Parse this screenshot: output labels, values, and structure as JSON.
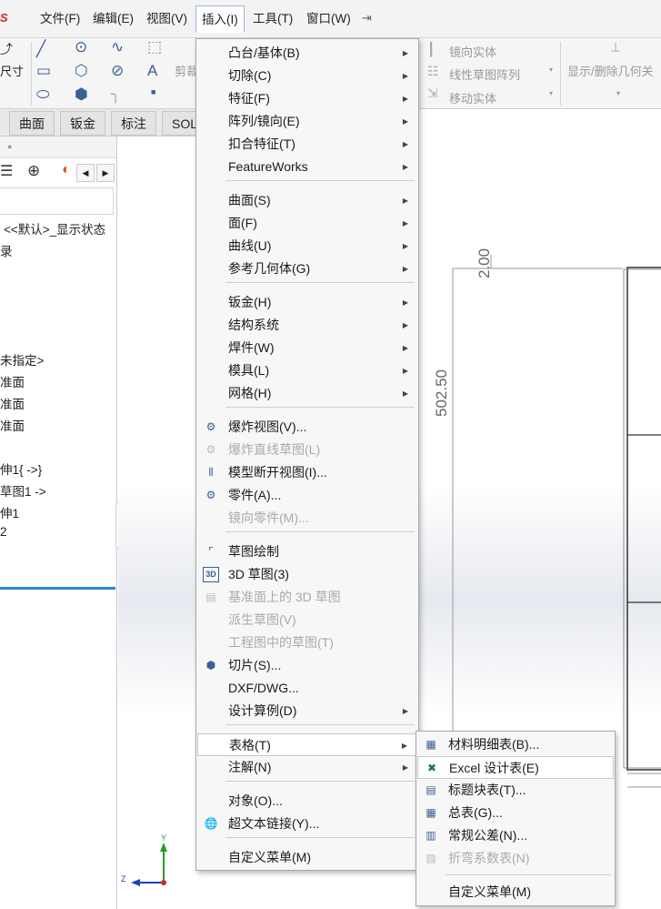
{
  "menubar": {
    "logo": "S",
    "items": [
      "文件(F)",
      "编辑(E)",
      "视图(V)",
      "插入(I)",
      "工具(T)",
      "窗口(W)"
    ],
    "pin_icon": "pin-icon"
  },
  "toolbar": {
    "smart_dim": "尺寸",
    "trim": "剪裁",
    "mirror": "镜向实体",
    "linear_pattern": "线性草图阵列",
    "move": "移动实体",
    "show_delete": "显示/删除几何关"
  },
  "tabs": [
    "曲面",
    "钣金",
    "标注",
    "SOL"
  ],
  "tree": {
    "display_state": "<<默认>_显示状态",
    "items": [
      "录",
      "未指定>",
      "准面",
      "准面",
      "准面",
      "伸1{ ->}",
      "草图1 ->",
      "伸1",
      "2"
    ]
  },
  "graphics": {
    "dim1": "2.00",
    "dim2": "502.50",
    "triad_y": "Y",
    "triad_z": "Z"
  },
  "insert_menu": {
    "items": [
      {
        "label": "凸台/基体(B)",
        "submenu": true
      },
      {
        "label": "切除(C)",
        "submenu": true
      },
      {
        "label": "特征(F)",
        "submenu": true
      },
      {
        "label": "阵列/镜向(E)",
        "submenu": true
      },
      {
        "label": "扣合特征(T)",
        "submenu": true
      },
      {
        "label": "FeatureWorks",
        "submenu": true
      },
      {
        "label": "曲面(S)",
        "submenu": true
      },
      {
        "label": "面(F)",
        "submenu": true
      },
      {
        "label": "曲线(U)",
        "submenu": true
      },
      {
        "label": "参考几何体(G)",
        "submenu": true
      },
      {
        "label": "钣金(H)",
        "submenu": true
      },
      {
        "label": "结构系统",
        "submenu": true
      },
      {
        "label": "焊件(W)",
        "submenu": true
      },
      {
        "label": "模具(L)",
        "submenu": true
      },
      {
        "label": "网格(H)",
        "submenu": true
      },
      {
        "label": "爆炸视图(V)...",
        "icon": "explode-view-icon"
      },
      {
        "label": "爆炸直线草图(L)",
        "icon": "explode-line-icon",
        "disabled": true
      },
      {
        "label": "模型断开视图(I)...",
        "icon": "break-view-icon"
      },
      {
        "label": "零件(A)...",
        "icon": "part-icon"
      },
      {
        "label": "镜向零件(M)...",
        "disabled": true
      },
      {
        "label": "草图绘制",
        "icon": "sketch-icon"
      },
      {
        "label": "3D 草图(3)",
        "icon": "3d-sketch-icon"
      },
      {
        "label": "基准面上的 3D 草图",
        "icon": "3d-sketch-plane-icon",
        "disabled": true
      },
      {
        "label": "派生草图(V)",
        "disabled": true
      },
      {
        "label": "工程图中的草图(T)",
        "disabled": true
      },
      {
        "label": "切片(S)...",
        "icon": "slice-icon"
      },
      {
        "label": "DXF/DWG..."
      },
      {
        "label": "设计算例(D)",
        "submenu": true
      },
      {
        "label": "表格(T)",
        "submenu": true,
        "highlighted": true
      },
      {
        "label": "注解(N)",
        "submenu": true
      },
      {
        "label": "对象(O)..."
      },
      {
        "label": "超文本链接(Y)...",
        "icon": "hyperlink-icon"
      },
      {
        "label": "自定义菜单(M)"
      }
    ]
  },
  "table_menu": {
    "items": [
      {
        "label": "材料明细表(B)...",
        "icon": "bom-icon"
      },
      {
        "label": "Excel 设计表(E)",
        "icon": "excel-design-table-icon",
        "highlighted": true
      },
      {
        "label": "标题块表(T)...",
        "icon": "title-block-table-icon"
      },
      {
        "label": "总表(G)...",
        "icon": "general-table-icon"
      },
      {
        "label": "常规公差(N)...",
        "icon": "tolerance-icon"
      },
      {
        "label": "折弯系数表(N)",
        "icon": "bend-table-icon",
        "disabled": true
      },
      {
        "label": "自定义菜单(M)"
      }
    ]
  },
  "colors": {
    "accent_blue": "#2e84c8",
    "logo_red": "#d2232a",
    "excel_green": "#1e7a3c"
  }
}
